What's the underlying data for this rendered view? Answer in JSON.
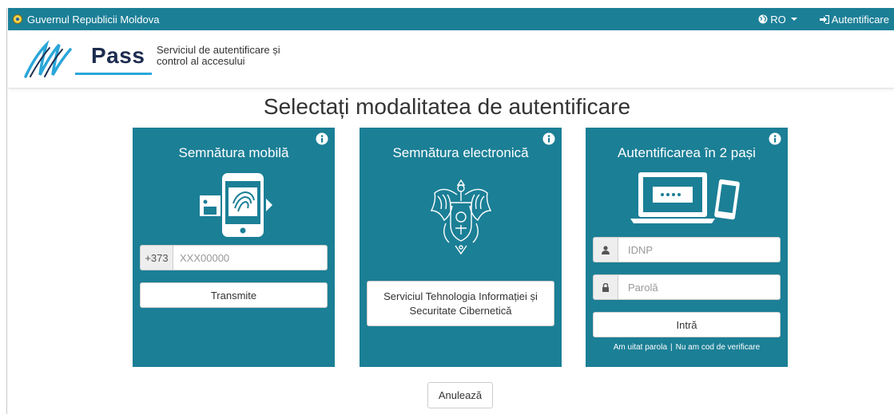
{
  "gov_bar": {
    "title": "Guvernul Republicii Moldova",
    "language": "RO",
    "login": "Autentificare"
  },
  "header": {
    "logo_text": "Pass",
    "tagline_line1": "Serviciul de autentificare și",
    "tagline_line2": "control al accesului"
  },
  "main": {
    "title": "Selectați modalitatea de autentificare",
    "cancel_label": "Anulează"
  },
  "cards": {
    "mobile": {
      "title": "Semnătura mobilă",
      "prefix": "+373",
      "phone_placeholder": "XXX00000",
      "submit_label": "Transmite"
    },
    "electronic": {
      "title": "Semnătura electronică",
      "provider_label": "Serviciul Tehnologia Informației și Securitate Cibernetică"
    },
    "two_step": {
      "title": "Autentificarea în 2 pași",
      "idnp_placeholder": "IDNP",
      "password_placeholder": "Parolă",
      "submit_label": "Intră",
      "forgot_label": "Am uitat parola",
      "separator": "|",
      "no_code_label": "Nu am cod de verificare"
    }
  },
  "colors": {
    "brand": "#1b7f96",
    "accent": "#2aa6d9"
  }
}
